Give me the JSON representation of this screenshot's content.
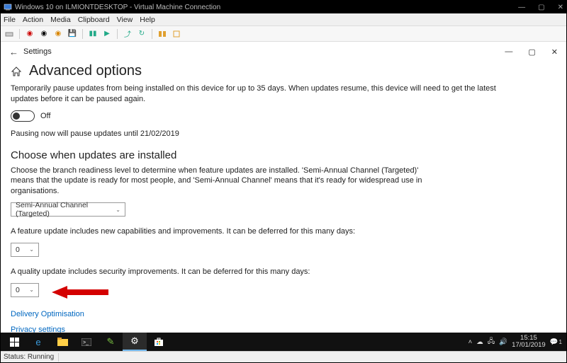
{
  "vm": {
    "title": "Windows 10 on ILMIONTDESKTOP - Virtual Machine Connection",
    "window_buttons": {
      "min": "—",
      "max": "▢",
      "close": "✕"
    },
    "menu": [
      "File",
      "Action",
      "Media",
      "Clipboard",
      "View",
      "Help"
    ],
    "status_label": "Status:",
    "status_value": "Running"
  },
  "settings_header": {
    "back_glyph": "←",
    "label": "Settings",
    "window_buttons": {
      "min": "—",
      "max": "▢",
      "close": "✕"
    }
  },
  "page": {
    "title": "Advanced options",
    "pause_desc": "Temporarily pause updates from being installed on this device for up to 35 days. When updates resume, this device will need to get the latest updates before it can be paused again.",
    "toggle_label": "Off",
    "pause_until_text": "Pausing now will pause updates until 21/02/2019",
    "choose_title": "Choose when updates are installed",
    "choose_desc": "Choose the branch readiness level to determine when feature updates are installed. 'Semi-Annual Channel (Targeted)' means that the update is ready for most people, and 'Semi-Annual Channel' means that it's ready for widespread use in organisations.",
    "branch_value": "Semi-Annual Channel (Targeted)",
    "feature_desc": "A feature update includes new capabilities and improvements. It can be deferred for this many days:",
    "feature_value": "0",
    "quality_desc": "A quality update includes security improvements. It can be deferred for this many days:",
    "quality_value": "0",
    "link_delivery": "Delivery Optimisation",
    "link_privacy": "Privacy settings"
  },
  "taskbar": {
    "time": "15:15",
    "date": "17/01/2019",
    "notif_count": "1"
  }
}
